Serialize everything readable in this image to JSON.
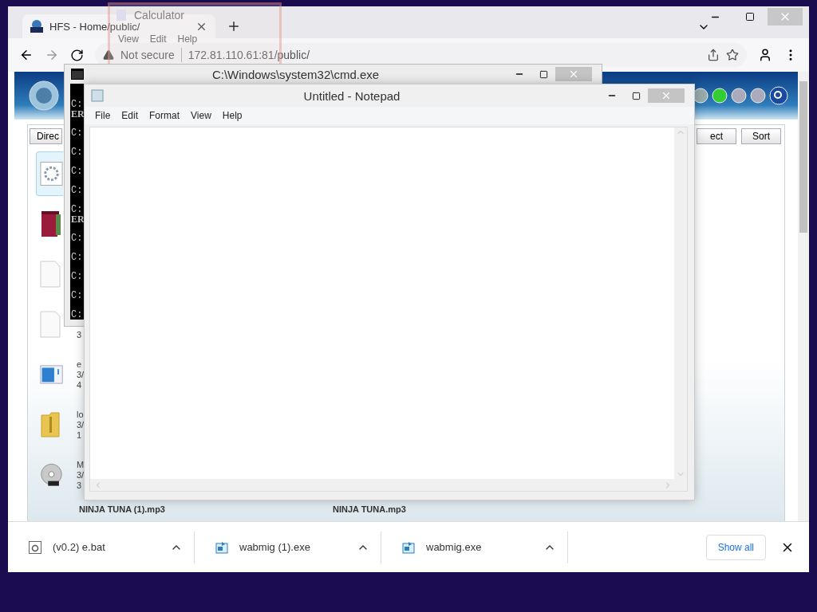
{
  "browser": {
    "tab": {
      "title": "HFS - Home/public/"
    },
    "address": {
      "security": "Not secure",
      "url": "172.81.110.61:81/public/"
    },
    "page": {
      "left_buttons": [
        "Direc"
      ],
      "right_buttons": [
        "ect",
        "Sort"
      ],
      "files": [
        {
          "kind": "settings",
          "selected": true
        },
        {
          "kind": "book",
          "selected": false
        },
        {
          "kind": "blank",
          "selected": false
        },
        {
          "kind": "blank",
          "selected": false,
          "size": "3"
        },
        {
          "kind": "window",
          "selected": false,
          "name": "e",
          "date": "3/",
          "size": "4"
        },
        {
          "kind": "zip",
          "selected": false,
          "name": "lo",
          "date": "3/",
          "size": "1"
        },
        {
          "kind": "disc",
          "selected": false,
          "name": "M",
          "date": "3/",
          "size": "3"
        }
      ],
      "more_files": [
        "NINJA TUNA (1).mp3",
        "NINJA TUNA.mp3"
      ]
    },
    "downloads": {
      "items": [
        {
          "name": "(v0.2) e.bat",
          "kind": "script"
        },
        {
          "name": "wabmig (1).exe",
          "kind": "exe"
        },
        {
          "name": "wabmig.exe",
          "kind": "exe"
        }
      ],
      "show_all": "Show all"
    }
  },
  "calculator": {
    "title": "Calculator",
    "menu": [
      "View",
      "Edit",
      "Help"
    ]
  },
  "cmd": {
    "title": "C:\\Windows\\system32\\cmd.exe",
    "lines": [
      {
        "text": "C:",
        "kind": "prompt"
      },
      {
        "text": "ER",
        "kind": "error"
      },
      {
        "text": "C:",
        "kind": "prompt"
      },
      {
        "text": "C:",
        "kind": "prompt"
      },
      {
        "text": "C:",
        "kind": "prompt"
      },
      {
        "text": "C:",
        "kind": "prompt"
      },
      {
        "text": "C:",
        "kind": "prompt"
      },
      {
        "text": "ER",
        "kind": "error"
      },
      {
        "text": "C:",
        "kind": "prompt"
      },
      {
        "text": "C:",
        "kind": "prompt"
      },
      {
        "text": "C:",
        "kind": "prompt"
      },
      {
        "text": "C:",
        "kind": "prompt"
      },
      {
        "text": "C:",
        "kind": "prompt"
      }
    ]
  },
  "notepad": {
    "title": "Untitled - Notepad",
    "menu": [
      "File",
      "Edit",
      "Format",
      "View",
      "Help"
    ]
  }
}
